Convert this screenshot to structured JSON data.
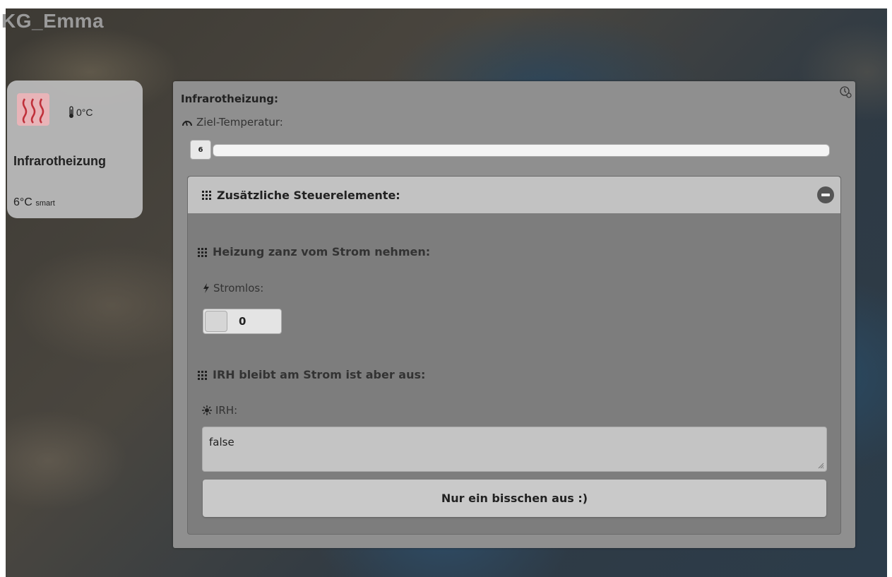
{
  "page": {
    "title": "KG_Emma"
  },
  "tile": {
    "icon": "heat-waves-icon",
    "temperature": "0°C",
    "name": "Infrarotheizung",
    "value": "6°C",
    "value_suffix": "smart"
  },
  "dialog": {
    "title": "Infrarotheizung:",
    "history_icon": "history-clock-icon",
    "target_label": "Ziel-Temperatur:",
    "slider_value": "6",
    "collapsible": {
      "title": "Zusätzliche Steuerelemente:",
      "section1": {
        "title": "Heizung zanz vom Strom nehmen:",
        "field_label": "Stromlos:",
        "toggle_value": "0"
      },
      "section2": {
        "title": "IRH bleibt am Strom ist aber aus:",
        "field_label": "IRH:",
        "textarea_value": "false",
        "button_label": "Nur ein bisschen aus :)"
      }
    }
  },
  "colors": {
    "tile_icon_bg": "#e8b4b8",
    "heat_icon": "#c0303a",
    "dialog_bg": "#8f8f8f",
    "panel_bg": "#7d7d7d"
  }
}
